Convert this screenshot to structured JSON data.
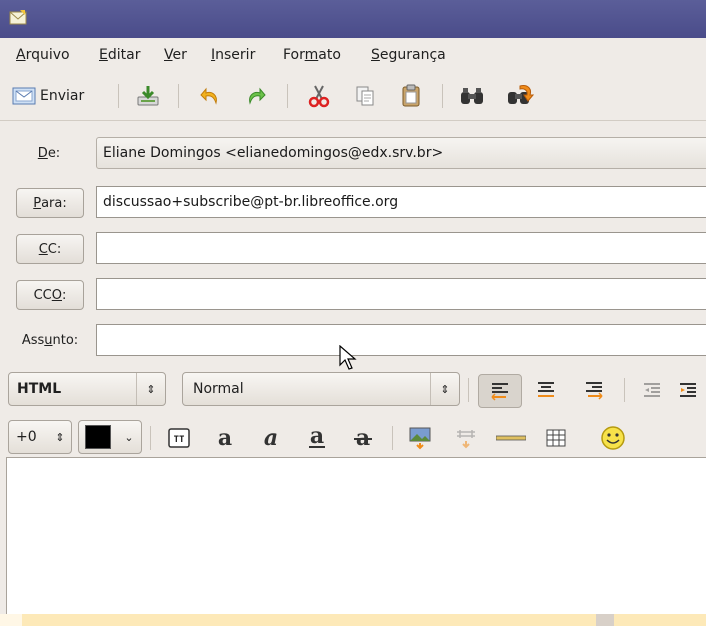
{
  "menubar": {
    "items": [
      {
        "prefix": "",
        "accel": "A",
        "rest": "rquivo"
      },
      {
        "prefix": "",
        "accel": "E",
        "rest": "ditar"
      },
      {
        "prefix": "",
        "accel": "V",
        "rest": "er"
      },
      {
        "prefix": "",
        "accel": "I",
        "rest": "nserir"
      },
      {
        "prefix": "For",
        "accel": "m",
        "rest": "ato"
      },
      {
        "prefix": "",
        "accel": "S",
        "rest": "egurança"
      }
    ]
  },
  "toolbar": {
    "send_label": "Enviar"
  },
  "headers": {
    "from": {
      "pre": "",
      "accel": "D",
      "post": "e:",
      "value": "Eliane Domingos <elianedomingos@edx.srv.br>"
    },
    "to": {
      "pre": "",
      "accel": "P",
      "post": "ara:",
      "value": "discussao+subscribe@pt-br.libreoffice.org"
    },
    "cc": {
      "pre": "",
      "accel": "C",
      "post": "C:",
      "value": ""
    },
    "bcc": {
      "pre": "CC",
      "accel": "O",
      "post": ":",
      "value": ""
    },
    "subject": {
      "pre": "Ass",
      "accel": "u",
      "post": "nto:",
      "value": ""
    }
  },
  "format_bar": {
    "mode": "HTML",
    "paragraph_style": "Normal",
    "font_size": "+0",
    "text_color": "#000000"
  },
  "colors": {
    "titlebar": "#4e5190",
    "accent_orange": "#f08c1a"
  }
}
